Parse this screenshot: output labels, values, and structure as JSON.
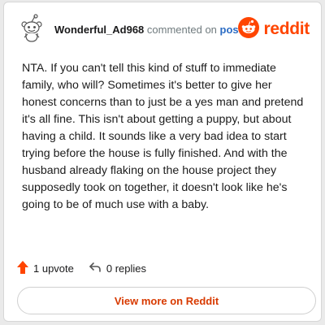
{
  "header": {
    "username": "Wonderful_Ad968",
    "action_text": "commented on",
    "post_link": "post"
  },
  "brand": {
    "name": "reddit",
    "color": "#ff4500"
  },
  "comment": {
    "text": "NTA. If you can't tell this kind of stuff to immediate family, who will? Sometimes it's better to give her honest concerns than to just be a yes man and pretend it's all fine. This isn't about getting a puppy, but about having a child. It sounds like a very bad idea to start trying before the house is fully finished. And with the husband already flaking on the house project they supposedly took on together, it doesn't look like he's going to be of much use with a baby."
  },
  "footer": {
    "upvotes": "1 upvote",
    "replies": "0 replies"
  },
  "cta": {
    "label": "View more on Reddit"
  },
  "icons": {
    "avatar": "snoo-avatar-icon",
    "brand_logo": "reddit-logo-icon",
    "upvote": "upvote-arrow-icon",
    "reply": "reply-arrow-icon"
  }
}
